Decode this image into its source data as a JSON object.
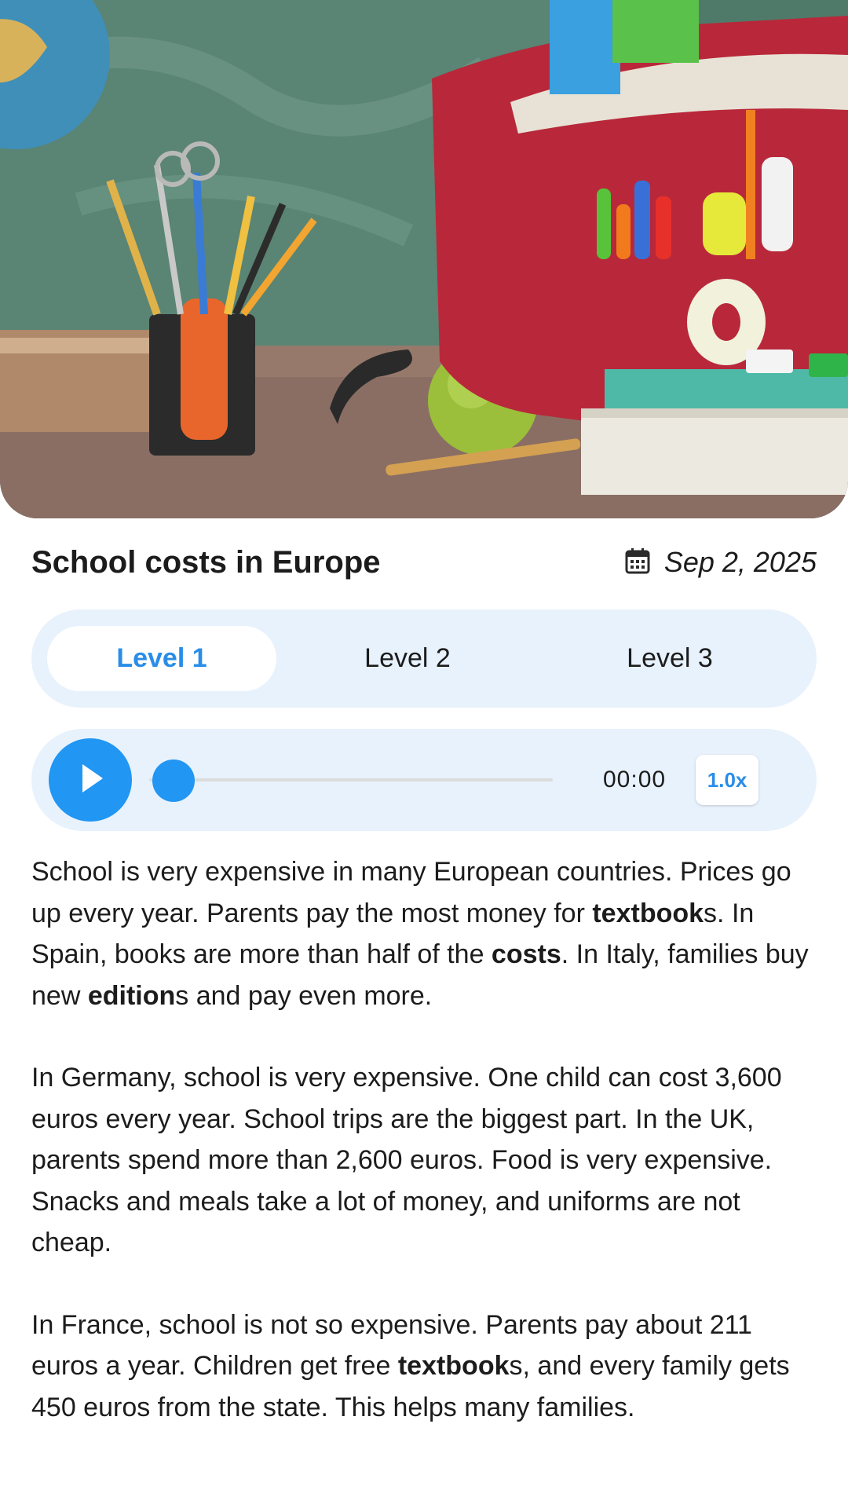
{
  "header": {
    "title": "School costs in Europe",
    "date": "Sep 2, 2025",
    "calendar_icon": "calendar-icon"
  },
  "levels": {
    "items": [
      "Level 1",
      "Level 2",
      "Level 3"
    ],
    "selected": "Level 1"
  },
  "player": {
    "time": "00:00",
    "speed": "1.0x",
    "progress": 0,
    "play_icon": "play-icon"
  },
  "article": {
    "paragraphs": [
      [
        {
          "t": "School is very expensive in many European countries. Prices go up every year. Parents pay the most money for "
        },
        {
          "t": "textbook",
          "b": true
        },
        {
          "t": "s. In Spain, books are more than half of the "
        },
        {
          "t": "costs",
          "b": true
        },
        {
          "t": ". In Italy, families buy new "
        },
        {
          "t": "edition",
          "b": true
        },
        {
          "t": "s and pay even more."
        }
      ],
      [
        {
          "t": "In Germany, school is very expensive. One child can cost 3,600 euros every year. School trips are the biggest part. In the UK, parents spend more than 2,600 euros. Food is very expensive. Snacks and meals take a lot of money, and uniforms are not cheap."
        }
      ],
      [
        {
          "t": "In France, school is not so expensive. Parents pay about 211 euros a year. Children get free "
        },
        {
          "t": "textbook",
          "b": true
        },
        {
          "t": "s, and every family gets 450 euros from the state. This helps many families."
        }
      ]
    ]
  },
  "colors": {
    "accent": "#2196f3",
    "accent_text": "#2a8de8",
    "panel_bg": "#e8f2fd"
  }
}
